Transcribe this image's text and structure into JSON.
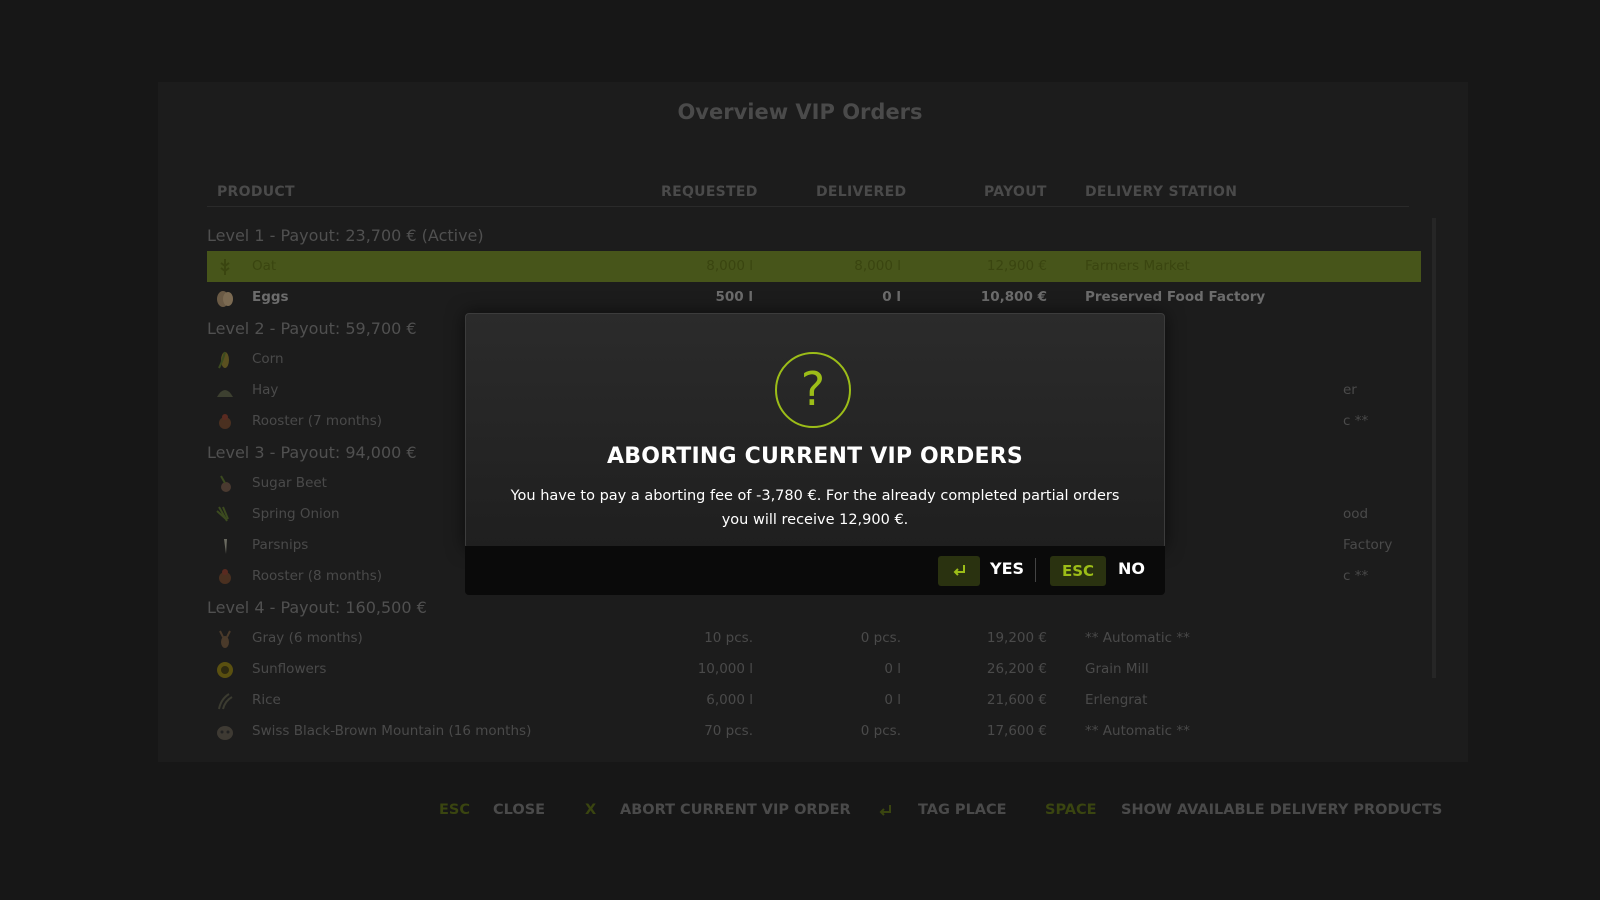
{
  "overview": {
    "title": "Overview VIP Orders",
    "columns": {
      "product": "PRODUCT",
      "requested": "REQUESTED",
      "delivered": "DELIVERED",
      "payout": "PAYOUT",
      "station": "DELIVERY STATION"
    },
    "level1": "Level 1 - Payout: 23,700 € (Active)",
    "row_oat": {
      "name": "Oat",
      "req": "8,000 l",
      "del": "8,000 l",
      "pay": "12,900 €",
      "sta": "Farmers Market"
    },
    "row_eggs": {
      "name": "Eggs",
      "req": "500 l",
      "del": "0 l",
      "pay": "10,800 €",
      "sta": "Preserved Food Factory"
    },
    "level2": "Level 2 - Payout: 59,700 €",
    "row_corn": {
      "name": "Corn"
    },
    "row_hay": {
      "name": "Hay",
      "sta": "er"
    },
    "row_rooster7": {
      "name": "Rooster (7 months)",
      "sta": "c **"
    },
    "level3": "Level 3 - Payout: 94,000 €",
    "row_sugarbeet": {
      "name": "Sugar Beet"
    },
    "row_springonion": {
      "name": "Spring Onion",
      "sta": "ood Factory"
    },
    "row_parsnips": {
      "name": "Parsnips"
    },
    "row_rooster8": {
      "name": "Rooster (8 months)",
      "sta": "c **"
    },
    "level4": "Level 4 - Payout: 160,500 €",
    "row_gray": {
      "name": "Gray (6 months)",
      "req": "10 pcs.",
      "del": "0 pcs.",
      "pay": "19,200 €",
      "sta": "** Automatic **"
    },
    "row_sunflowers": {
      "name": "Sunflowers",
      "req": "10,000 l",
      "del": "0 l",
      "pay": "26,200 €",
      "sta": "Grain Mill"
    },
    "row_rice": {
      "name": "Rice",
      "req": "6,000 l",
      "del": "0 l",
      "pay": "21,600 €",
      "sta": "Erlengrat"
    },
    "row_swiss": {
      "name": "Swiss Black-Brown Mountain (16 months)",
      "req": "70 pcs.",
      "del": "0 pcs.",
      "pay": "17,600 €",
      "sta": "** Automatic **"
    }
  },
  "footer": {
    "esc_key": "ESC",
    "close": "CLOSE",
    "x_key": "X",
    "abort": "ABORT CURRENT VIP ORDER",
    "tag": "TAG PLACE",
    "space_key": "SPACE",
    "show": "SHOW AVAILABLE DELIVERY PRODUCTS"
  },
  "dialog": {
    "icon": "?",
    "title": "ABORTING CURRENT VIP ORDERS",
    "text": "You have to pay a aborting fee of -3,780 €. For the already completed partial orders you will receive 12,900 €.",
    "yes": "YES",
    "esc_key": "ESC",
    "no": "NO"
  },
  "colors": {
    "accent": "#9cbd18",
    "active_row": "#47551a"
  }
}
